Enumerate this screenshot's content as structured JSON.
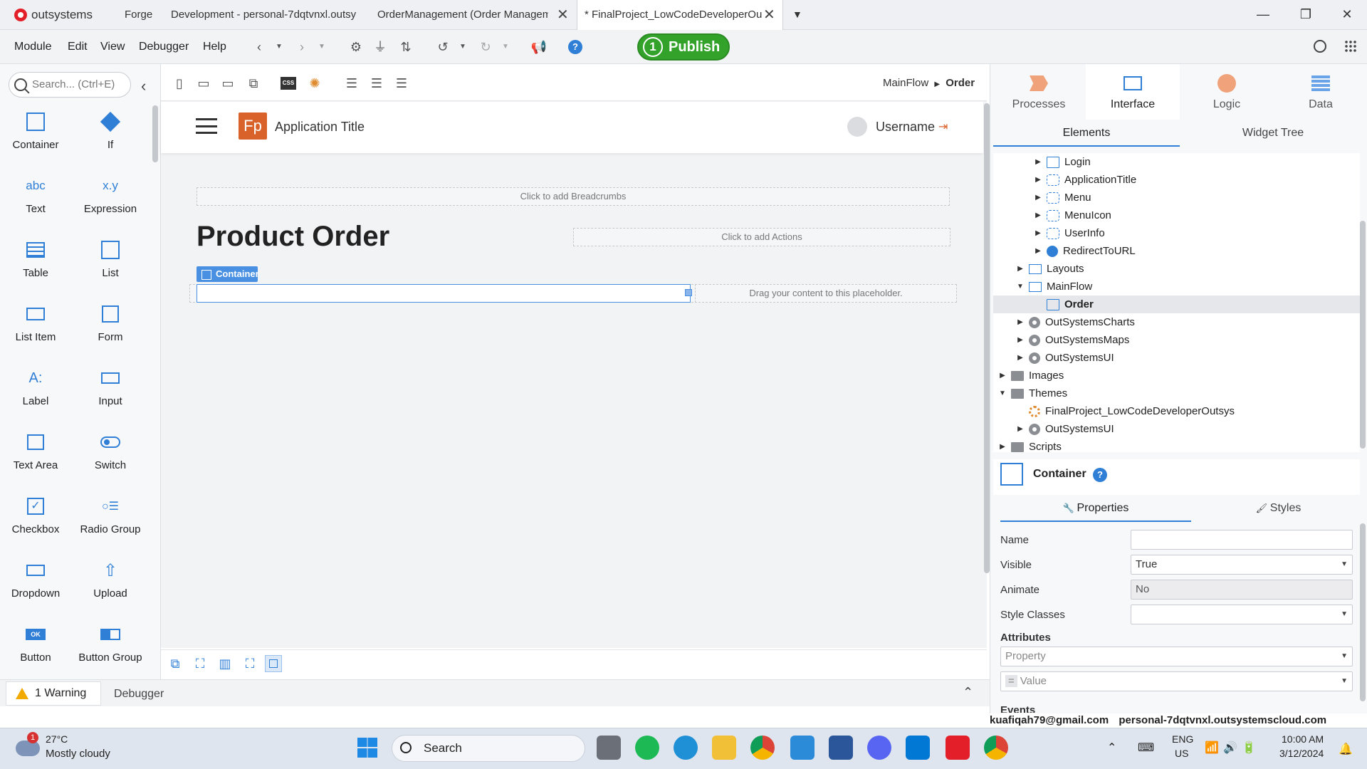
{
  "titlebar": {
    "brand": "outsystems",
    "tabs": [
      {
        "label": "Forge"
      },
      {
        "label": "Development - personal-7dqtvnxl.outsy"
      },
      {
        "label": "OrderManagement (Order Managem"
      },
      {
        "label": "* FinalProject_LowCodeDeveloperOu"
      }
    ]
  },
  "menubar": {
    "items": [
      "Module",
      "Edit",
      "View",
      "Debugger",
      "Help"
    ],
    "publish_number": "1",
    "publish_label": "Publish"
  },
  "toolbox": {
    "search_placeholder": "Search... (Ctrl+E)",
    "tools": [
      {
        "label": "Container",
        "icon": "container-icon"
      },
      {
        "label": "If",
        "icon": "if-diamond-icon"
      },
      {
        "label": "Text",
        "icon": "text-abc-icon"
      },
      {
        "label": "Expression",
        "icon": "expression-icon"
      },
      {
        "label": "Table",
        "icon": "table-icon"
      },
      {
        "label": "List",
        "icon": "list-icon"
      },
      {
        "label": "List Item",
        "icon": "list-item-icon"
      },
      {
        "label": "Form",
        "icon": "form-icon"
      },
      {
        "label": "Label",
        "icon": "label-icon"
      },
      {
        "label": "Input",
        "icon": "input-icon"
      },
      {
        "label": "Text Area",
        "icon": "text-area-icon"
      },
      {
        "label": "Switch",
        "icon": "switch-icon"
      },
      {
        "label": "Checkbox",
        "icon": "checkbox-icon"
      },
      {
        "label": "Radio Group",
        "icon": "radio-group-icon"
      },
      {
        "label": "Dropdown",
        "icon": "dropdown-icon"
      },
      {
        "label": "Upload",
        "icon": "upload-icon"
      },
      {
        "label": "Button",
        "icon": "button-icon"
      },
      {
        "label": "Button Group",
        "icon": "button-group-icon"
      }
    ]
  },
  "canvas": {
    "breadcrumb_parent": "MainFlow",
    "breadcrumb_current": "Order",
    "app_logo_text": "Fp",
    "app_title": "Application Title",
    "username": "Username",
    "breadcrumbs_placeholder": "Click to add Breadcrumbs",
    "page_title": "Product Order",
    "actions_placeholder": "Click to add Actions",
    "container_tag": "Container",
    "drop_placeholder": "Drag your content to this placeholder."
  },
  "status": {
    "warning_label": "1 Warning",
    "debugger_label": "Debugger"
  },
  "rpanel": {
    "tabs": [
      "Processes",
      "Interface",
      "Logic",
      "Data"
    ],
    "active_tab": "Interface",
    "subtabs": [
      "Elements",
      "Widget Tree"
    ],
    "tree": [
      {
        "label": "Login",
        "indent": 2,
        "icon": "screen",
        "arrow": "right"
      },
      {
        "label": "ApplicationTitle",
        "indent": 2,
        "icon": "block",
        "arrow": "right"
      },
      {
        "label": "Menu",
        "indent": 2,
        "icon": "block",
        "arrow": "right"
      },
      {
        "label": "MenuIcon",
        "indent": 2,
        "icon": "block",
        "arrow": "right"
      },
      {
        "label": "UserInfo",
        "indent": 2,
        "icon": "block",
        "arrow": "right"
      },
      {
        "label": "RedirectToURL",
        "indent": 2,
        "icon": "web",
        "arrow": "right"
      },
      {
        "label": "Layouts",
        "indent": 1,
        "icon": "flow",
        "arrow": "right"
      },
      {
        "label": "MainFlow",
        "indent": 1,
        "icon": "flow",
        "arrow": "down"
      },
      {
        "label": "Order",
        "indent": 2,
        "icon": "screen",
        "arrow": "",
        "selected": true
      },
      {
        "label": "OutSystemsCharts",
        "indent": 1,
        "icon": "module",
        "arrow": "right"
      },
      {
        "label": "OutSystemsMaps",
        "indent": 1,
        "icon": "module",
        "arrow": "right"
      },
      {
        "label": "OutSystemsUI",
        "indent": 1,
        "icon": "module",
        "arrow": "right"
      },
      {
        "label": "Images",
        "indent": 0,
        "icon": "folder",
        "arrow": "right"
      },
      {
        "label": "Themes",
        "indent": 0,
        "icon": "folder",
        "arrow": "down"
      },
      {
        "label": "FinalProject_LowCodeDeveloperOutsys",
        "indent": 1,
        "icon": "theme",
        "arrow": ""
      },
      {
        "label": "OutSystemsUI",
        "indent": 1,
        "icon": "module",
        "arrow": "right"
      },
      {
        "label": "Scripts",
        "indent": 0,
        "icon": "folder",
        "arrow": "right"
      }
    ],
    "properties": {
      "element_name": "Container",
      "tab_properties": "Properties",
      "tab_styles": "Styles",
      "name_label": "Name",
      "name_value": "",
      "visible_label": "Visible",
      "visible_value": "True",
      "animate_label": "Animate",
      "animate_value": "No",
      "style_classes_label": "Style Classes",
      "style_classes_value": "",
      "attributes_label": "Attributes",
      "property_placeholder": "Property",
      "value_prefix": "=",
      "value_placeholder": "Value",
      "events_label": "Events"
    },
    "footer_email": "kuafiqah79@gmail.com",
    "footer_env": "personal-7dqtvnxl.outsystemscloud.com"
  },
  "taskbar": {
    "weather_badge": "1",
    "temperature": "27°C",
    "weather_desc": "Mostly cloudy",
    "search_label": "Search",
    "lang_line1": "ENG",
    "lang_line2": "US",
    "time": "10:00 AM",
    "date": "3/12/2024"
  }
}
